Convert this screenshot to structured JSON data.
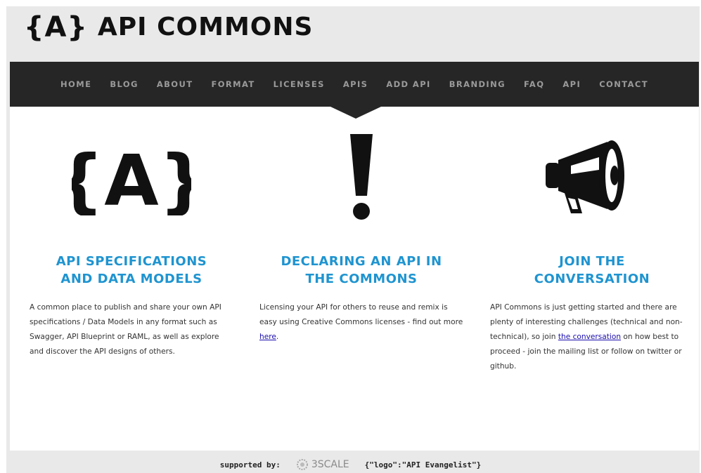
{
  "header": {
    "logo_mark": "{A}",
    "site_name": "API COMMONS"
  },
  "nav": {
    "items": [
      "HOME",
      "BLOG",
      "ABOUT",
      "FORMAT",
      "LICENSES",
      "APIS",
      "ADD API",
      "BRANDING",
      "FAQ",
      "API",
      "CONTACT"
    ]
  },
  "columns": [
    {
      "icon": "braces-a-logo-icon",
      "icon_text": "{A}",
      "title": "API SPECIFICATIONS\nAND DATA MODELS",
      "text": "A common place to publish and share your own API specifications / Data Models in any format such as Swagger, API Blueprint or RAML, as well as explore and discover the API designs of others."
    },
    {
      "icon": "exclamation-icon",
      "title": "DECLARING AN API IN\nTHE COMMONS",
      "text_before": "Licensing your API for others to reuse and remix is easy using Creative Commons licenses - find out more ",
      "link": "here",
      "text_after": "."
    },
    {
      "icon": "megaphone-icon",
      "title": "JOIN THE\nCONVERSATION",
      "text_before": "API Commons is just getting started and there are plenty of interesting challenges (technical and non-technical), so join ",
      "link": "the conversation",
      "text_after": " on how best to proceed - join the mailing list or follow on twitter or github."
    }
  ],
  "footer": {
    "supported_by": "supported by:",
    "sponsor_1": "3SCALE",
    "sponsor_2": "{\"logo\":\"API Evangelist\"}"
  }
}
